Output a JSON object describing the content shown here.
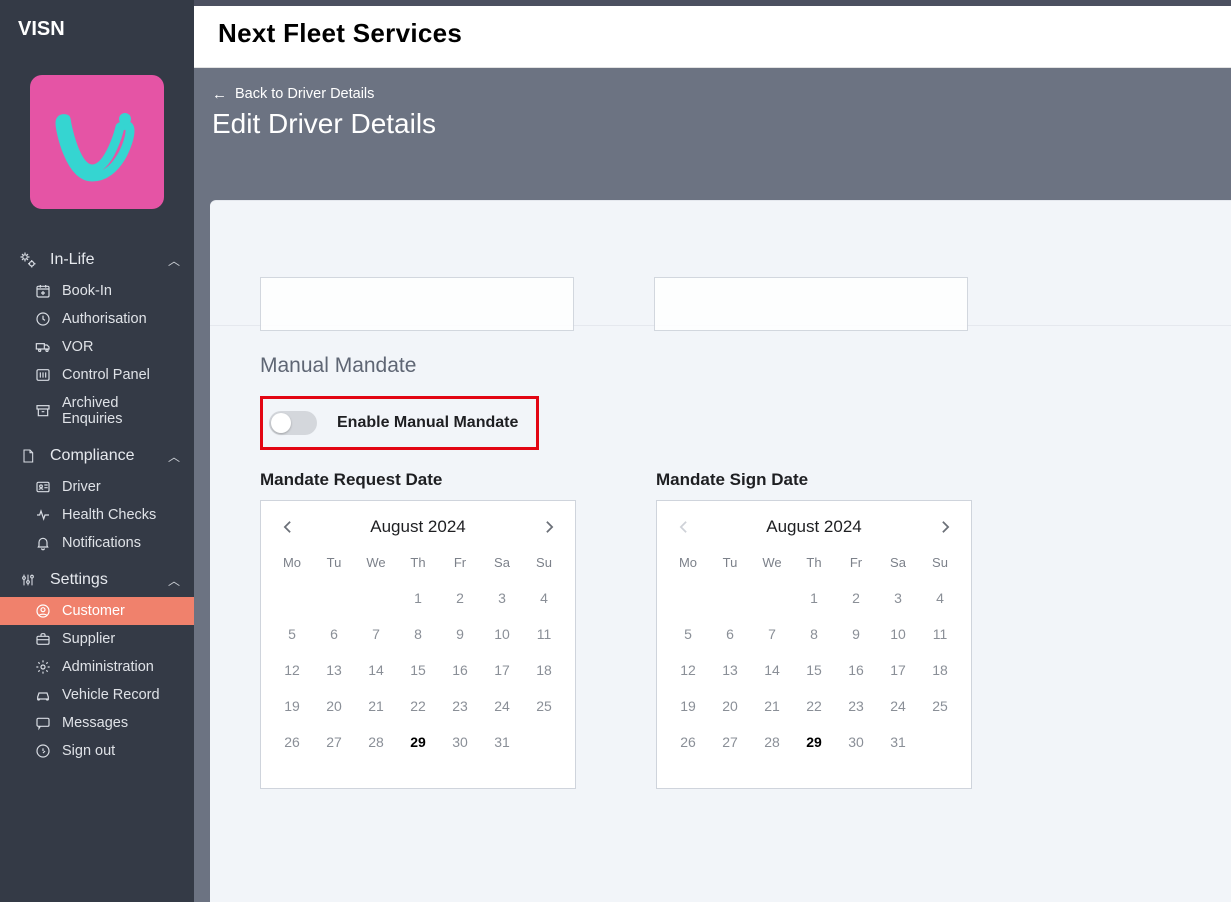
{
  "app": {
    "name": "VISN"
  },
  "header": {
    "title": "Next Fleet Services"
  },
  "breadcrumb": {
    "back_label": "Back to Driver Details"
  },
  "page": {
    "title": "Edit Driver Details"
  },
  "sidebar": {
    "sections": [
      {
        "label": "In-Life",
        "expanded": true,
        "items": [
          {
            "icon": "calendar-plus-icon",
            "label": "Book-In"
          },
          {
            "icon": "clock-icon",
            "label": "Authorisation"
          },
          {
            "icon": "truck-icon",
            "label": "VOR"
          },
          {
            "icon": "sliders-icon",
            "label": "Control Panel"
          },
          {
            "icon": "archive-icon",
            "label": "Archived Enquiries"
          }
        ]
      },
      {
        "label": "Compliance",
        "expanded": true,
        "items": [
          {
            "icon": "id-card-icon",
            "label": "Driver"
          },
          {
            "icon": "activity-icon",
            "label": "Health Checks"
          },
          {
            "icon": "bell-icon",
            "label": "Notifications"
          }
        ]
      },
      {
        "label": "Settings",
        "expanded": true,
        "items": [
          {
            "icon": "user-circle-icon",
            "label": "Customer",
            "active": true
          },
          {
            "icon": "briefcase-icon",
            "label": "Supplier"
          },
          {
            "icon": "gear-icon",
            "label": "Administration"
          },
          {
            "icon": "car-icon",
            "label": "Vehicle Record"
          },
          {
            "icon": "chat-icon",
            "label": "Messages"
          },
          {
            "icon": "signout-icon",
            "label": "Sign out"
          }
        ]
      }
    ]
  },
  "mandate": {
    "heading": "Manual Mandate",
    "toggle_label": "Enable Manual Mandate",
    "toggle_on": false
  },
  "calendars": {
    "request": {
      "title": "Mandate Request Date",
      "month": "August 2024",
      "prev_enabled": true,
      "next_enabled": true,
      "today": 29
    },
    "sign": {
      "title": "Mandate Sign Date",
      "month": "August 2024",
      "prev_enabled": false,
      "next_enabled": true,
      "today": 29
    },
    "weekdays": [
      "Mo",
      "Tu",
      "We",
      "Th",
      "Fr",
      "Sa",
      "Su"
    ],
    "grid": [
      [
        "",
        "",
        "",
        "1",
        "2",
        "3",
        "4"
      ],
      [
        "5",
        "6",
        "7",
        "8",
        "9",
        "10",
        "11"
      ],
      [
        "12",
        "13",
        "14",
        "15",
        "16",
        "17",
        "18"
      ],
      [
        "19",
        "20",
        "21",
        "22",
        "23",
        "24",
        "25"
      ],
      [
        "26",
        "27",
        "28",
        "29",
        "30",
        "31",
        ""
      ]
    ]
  }
}
